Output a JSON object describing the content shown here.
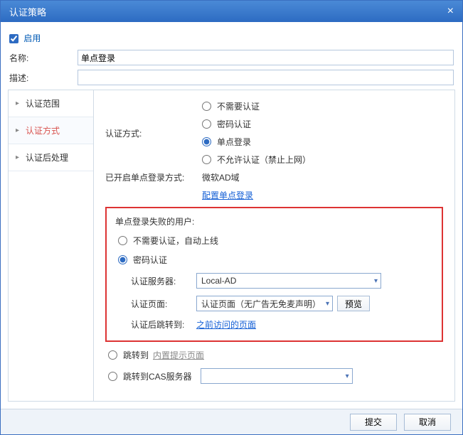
{
  "titlebar": {
    "title": "认证策略"
  },
  "enable": {
    "label": "启用",
    "checked": true
  },
  "fields": {
    "name_label": "名称:",
    "name_value": "单点登录",
    "desc_label": "描述:",
    "desc_value": ""
  },
  "sidebar": {
    "items": [
      {
        "label": "认证范围"
      },
      {
        "label": "认证方式"
      },
      {
        "label": "认证后处理"
      }
    ]
  },
  "authmethod": {
    "label": "认证方式:",
    "options": {
      "none": "不需要认证",
      "password": "密码认证",
      "sso": "单点登录",
      "deny": "不允许认证（禁止上网）"
    },
    "enabled_label": "已开启单点登录方式:",
    "enabled_value": "微软AD域",
    "config_link": "配置单点登录"
  },
  "fail": {
    "title": "单点登录失败的用户:",
    "opt_none": "不需要认证，自动上线",
    "opt_password": "密码认证",
    "server_label": "认证服务器:",
    "server_value": "Local-AD",
    "page_label": "认证页面:",
    "page_value": "认证页面（无广告无免麦声明）",
    "preview_btn": "预览",
    "redirect_label": "认证后跳转到:",
    "redirect_link": "之前访问的页面"
  },
  "extra": {
    "jump_to": "跳转到",
    "builtin_page": "内置提示页面",
    "jump_cas": "跳转到CAS服务器",
    "cas_value": ""
  },
  "footer": {
    "submit": "提交",
    "cancel": "取消"
  }
}
